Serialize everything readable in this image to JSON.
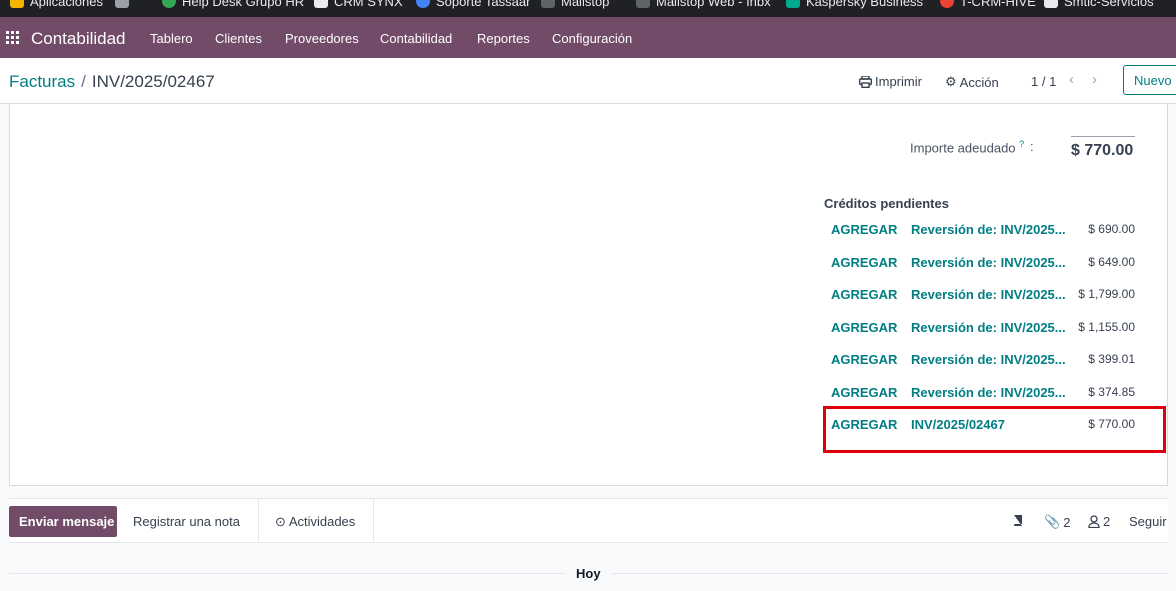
{
  "bookmarks": [
    {
      "label": "Aplicaciones",
      "color": "#f4b400"
    },
    {
      "label": "",
      "color": "#9aa0a6"
    },
    {
      "label": "Help Desk Grupo HR",
      "color": "#34a853"
    },
    {
      "label": "CRM SYNX",
      "color": "#e8eaed"
    },
    {
      "label": "Soporte Tassaar",
      "color": "#4285f4"
    },
    {
      "label": "Mailstop",
      "color": "#5f6368"
    },
    {
      "label": "Mailstop Web - Inbx",
      "color": "#5f6368"
    },
    {
      "label": "Kaspersky Business",
      "color": "#00a88e"
    },
    {
      "label": "T-CRM-HIVE",
      "color": "#ea4335"
    },
    {
      "label": "Smtic-Servicios",
      "color": "#e8eaed"
    }
  ],
  "navbar": {
    "brand": "Contabilidad",
    "items": [
      "Tablero",
      "Clientes",
      "Proveedores",
      "Contabilidad",
      "Reportes",
      "Configuración"
    ]
  },
  "control": {
    "breadcrumb_parent": "Facturas",
    "breadcrumb_sep": "/",
    "breadcrumb_current": "INV/2025/02467",
    "print_label": "Imprimir",
    "action_label": "Acción",
    "pager": "1 / 1",
    "new_label": "Nuevo"
  },
  "summary": {
    "amount_due_label": "Importe adeudado",
    "amount_due_help": "?",
    "amount_due_colon": ":",
    "amount_due_value": "$ 770.00"
  },
  "credits": {
    "title": "Créditos pendientes",
    "rows": [
      {
        "action": "AGREGAR",
        "ref": "Reversión de: INV/2025...",
        "amount": "$ 690.00"
      },
      {
        "action": "AGREGAR",
        "ref": "Reversión de: INV/2025...",
        "amount": "$ 649.00"
      },
      {
        "action": "AGREGAR",
        "ref": "Reversión de: INV/2025...",
        "amount": "$ 1,799.00"
      },
      {
        "action": "AGREGAR",
        "ref": "Reversión de: INV/2025...",
        "amount": "$ 1,155.00"
      },
      {
        "action": "AGREGAR",
        "ref": "Reversión de: INV/2025...",
        "amount": "$ 399.01"
      },
      {
        "action": "AGREGAR",
        "ref": "Reversión de: INV/2025...",
        "amount": "$ 374.85"
      },
      {
        "action": "AGREGAR",
        "ref": "INV/2025/02467",
        "amount": "$ 770.00"
      }
    ],
    "highlight_color": "#e0000b"
  },
  "chatter": {
    "send_label": "Enviar mensaje",
    "note_label": "Registrar una nota",
    "activities_label": "Actividades",
    "attachments_count": "2",
    "followers_count": "2",
    "follow_label": "Seguir",
    "today_label": "Hoy"
  },
  "colors": {
    "brand": "#714b67",
    "link": "#017e84"
  }
}
